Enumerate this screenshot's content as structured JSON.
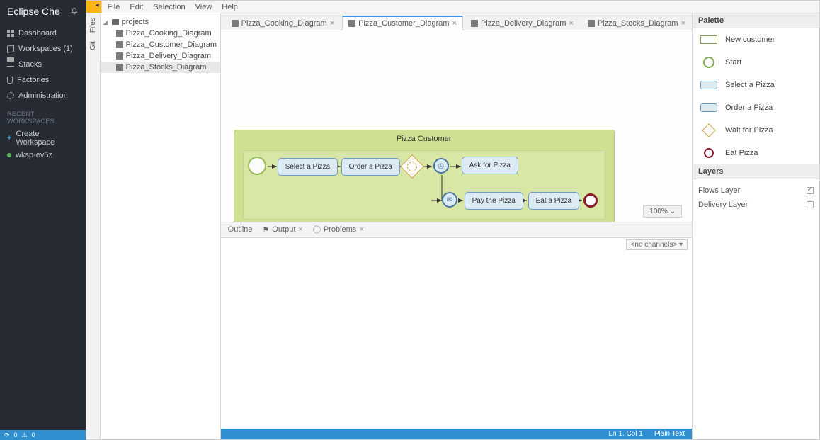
{
  "leftbar": {
    "title": "Eclipse Che",
    "menu": [
      {
        "label": "Dashboard",
        "icon": "dash"
      },
      {
        "label": "Workspaces (1)",
        "icon": "cube"
      },
      {
        "label": "Stacks",
        "icon": "stack"
      },
      {
        "label": "Factories",
        "icon": "flask"
      },
      {
        "label": "Administration",
        "icon": "gear"
      }
    ],
    "recent_header": "RECENT WORKSPACES",
    "recent": [
      {
        "label": "Create Workspace",
        "kind": "create"
      },
      {
        "label": "wksp-ev5z",
        "kind": "ws"
      }
    ],
    "footer_err": "0",
    "footer_warn": "0"
  },
  "menubar": [
    "File",
    "Edit",
    "Selection",
    "View",
    "Help"
  ],
  "rail": [
    {
      "label": "Files"
    },
    {
      "label": "Git"
    }
  ],
  "filetree": {
    "root": "projects",
    "files": [
      {
        "name": "Pizza_Cooking_Diagram",
        "sel": false
      },
      {
        "name": "Pizza_Customer_Diagram",
        "sel": false
      },
      {
        "name": "Pizza_Delivery_Diagram",
        "sel": false
      },
      {
        "name": "Pizza_Stocks_Diagram",
        "sel": true
      }
    ]
  },
  "tabs": [
    {
      "label": "Pizza_Cooking_Diagram",
      "active": false
    },
    {
      "label": "Pizza_Customer_Diagram",
      "active": true
    },
    {
      "label": "Pizza_Delivery_Diagram",
      "active": false
    },
    {
      "label": "Pizza_Stocks_Diagram",
      "active": false
    }
  ],
  "diagram": {
    "pool_title": "Pizza Customer",
    "tasks": {
      "select": "Select a Pizza",
      "order": "Order a Pizza",
      "ask": "Ask for Pizza",
      "pay": "Pay the Pizza",
      "eat": "Eat a Pizza"
    },
    "zoom": "100%"
  },
  "bottom_tabs": [
    {
      "label": "Outline",
      "icon": "",
      "closable": false
    },
    {
      "label": "Output",
      "icon": "flag",
      "closable": true
    },
    {
      "label": "Problems",
      "icon": "info",
      "closable": true
    }
  ],
  "channels": "<no channels>",
  "statusbar": {
    "pos": "Ln 1, Col 1",
    "mode": "Plain Text"
  },
  "palette": {
    "title": "Palette",
    "items": [
      {
        "label": "New customer",
        "icon": "rect"
      },
      {
        "label": "Start",
        "icon": "circ"
      },
      {
        "label": "Select a Pizza",
        "icon": "task"
      },
      {
        "label": "Order a Pizza",
        "icon": "task"
      },
      {
        "label": "Wait for Pizza",
        "icon": "gw"
      },
      {
        "label": "Eat Pizza",
        "icon": "end"
      }
    ]
  },
  "layers": {
    "title": "Layers",
    "items": [
      {
        "label": "Flows Layer",
        "on": true
      },
      {
        "label": "Delivery Layer",
        "on": false
      }
    ]
  }
}
